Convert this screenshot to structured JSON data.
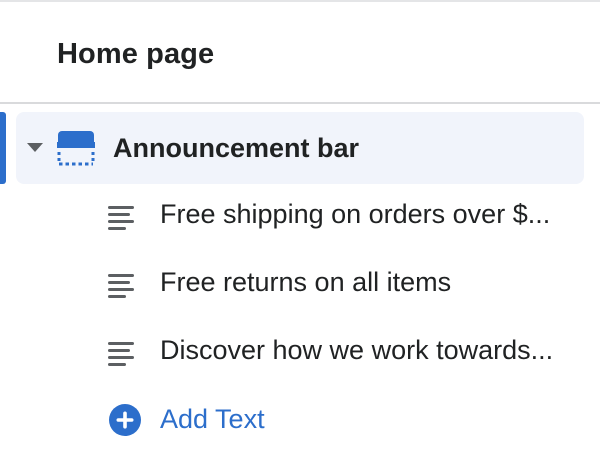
{
  "header": {
    "title": "Home page"
  },
  "section": {
    "label": "Announcement bar",
    "icon": "announcement-bar-icon",
    "expanded": true,
    "accent_color": "#2c6ecb",
    "selected_bg": "#f1f4fb"
  },
  "blocks": [
    {
      "label": "Free shipping on orders over $...",
      "icon": "text-lines-icon"
    },
    {
      "label": "Free returns on all items",
      "icon": "text-lines-icon"
    },
    {
      "label": "Discover how we work towards...",
      "icon": "text-lines-icon"
    }
  ],
  "add_block": {
    "label": "Add Text",
    "icon": "plus-circle-icon",
    "color": "#2c6ecb"
  }
}
